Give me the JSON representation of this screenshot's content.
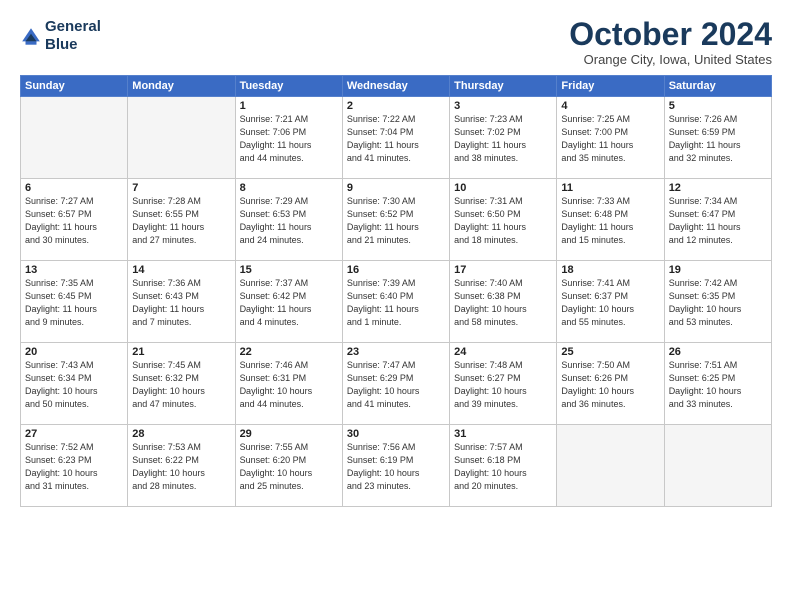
{
  "header": {
    "logo_line1": "General",
    "logo_line2": "Blue",
    "month": "October 2024",
    "location": "Orange City, Iowa, United States"
  },
  "days_of_week": [
    "Sunday",
    "Monday",
    "Tuesday",
    "Wednesday",
    "Thursday",
    "Friday",
    "Saturday"
  ],
  "weeks": [
    [
      {
        "day": "",
        "info": ""
      },
      {
        "day": "",
        "info": ""
      },
      {
        "day": "1",
        "info": "Sunrise: 7:21 AM\nSunset: 7:06 PM\nDaylight: 11 hours\nand 44 minutes."
      },
      {
        "day": "2",
        "info": "Sunrise: 7:22 AM\nSunset: 7:04 PM\nDaylight: 11 hours\nand 41 minutes."
      },
      {
        "day": "3",
        "info": "Sunrise: 7:23 AM\nSunset: 7:02 PM\nDaylight: 11 hours\nand 38 minutes."
      },
      {
        "day": "4",
        "info": "Sunrise: 7:25 AM\nSunset: 7:00 PM\nDaylight: 11 hours\nand 35 minutes."
      },
      {
        "day": "5",
        "info": "Sunrise: 7:26 AM\nSunset: 6:59 PM\nDaylight: 11 hours\nand 32 minutes."
      }
    ],
    [
      {
        "day": "6",
        "info": "Sunrise: 7:27 AM\nSunset: 6:57 PM\nDaylight: 11 hours\nand 30 minutes."
      },
      {
        "day": "7",
        "info": "Sunrise: 7:28 AM\nSunset: 6:55 PM\nDaylight: 11 hours\nand 27 minutes."
      },
      {
        "day": "8",
        "info": "Sunrise: 7:29 AM\nSunset: 6:53 PM\nDaylight: 11 hours\nand 24 minutes."
      },
      {
        "day": "9",
        "info": "Sunrise: 7:30 AM\nSunset: 6:52 PM\nDaylight: 11 hours\nand 21 minutes."
      },
      {
        "day": "10",
        "info": "Sunrise: 7:31 AM\nSunset: 6:50 PM\nDaylight: 11 hours\nand 18 minutes."
      },
      {
        "day": "11",
        "info": "Sunrise: 7:33 AM\nSunset: 6:48 PM\nDaylight: 11 hours\nand 15 minutes."
      },
      {
        "day": "12",
        "info": "Sunrise: 7:34 AM\nSunset: 6:47 PM\nDaylight: 11 hours\nand 12 minutes."
      }
    ],
    [
      {
        "day": "13",
        "info": "Sunrise: 7:35 AM\nSunset: 6:45 PM\nDaylight: 11 hours\nand 9 minutes."
      },
      {
        "day": "14",
        "info": "Sunrise: 7:36 AM\nSunset: 6:43 PM\nDaylight: 11 hours\nand 7 minutes."
      },
      {
        "day": "15",
        "info": "Sunrise: 7:37 AM\nSunset: 6:42 PM\nDaylight: 11 hours\nand 4 minutes."
      },
      {
        "day": "16",
        "info": "Sunrise: 7:39 AM\nSunset: 6:40 PM\nDaylight: 11 hours\nand 1 minute."
      },
      {
        "day": "17",
        "info": "Sunrise: 7:40 AM\nSunset: 6:38 PM\nDaylight: 10 hours\nand 58 minutes."
      },
      {
        "day": "18",
        "info": "Sunrise: 7:41 AM\nSunset: 6:37 PM\nDaylight: 10 hours\nand 55 minutes."
      },
      {
        "day": "19",
        "info": "Sunrise: 7:42 AM\nSunset: 6:35 PM\nDaylight: 10 hours\nand 53 minutes."
      }
    ],
    [
      {
        "day": "20",
        "info": "Sunrise: 7:43 AM\nSunset: 6:34 PM\nDaylight: 10 hours\nand 50 minutes."
      },
      {
        "day": "21",
        "info": "Sunrise: 7:45 AM\nSunset: 6:32 PM\nDaylight: 10 hours\nand 47 minutes."
      },
      {
        "day": "22",
        "info": "Sunrise: 7:46 AM\nSunset: 6:31 PM\nDaylight: 10 hours\nand 44 minutes."
      },
      {
        "day": "23",
        "info": "Sunrise: 7:47 AM\nSunset: 6:29 PM\nDaylight: 10 hours\nand 41 minutes."
      },
      {
        "day": "24",
        "info": "Sunrise: 7:48 AM\nSunset: 6:27 PM\nDaylight: 10 hours\nand 39 minutes."
      },
      {
        "day": "25",
        "info": "Sunrise: 7:50 AM\nSunset: 6:26 PM\nDaylight: 10 hours\nand 36 minutes."
      },
      {
        "day": "26",
        "info": "Sunrise: 7:51 AM\nSunset: 6:25 PM\nDaylight: 10 hours\nand 33 minutes."
      }
    ],
    [
      {
        "day": "27",
        "info": "Sunrise: 7:52 AM\nSunset: 6:23 PM\nDaylight: 10 hours\nand 31 minutes."
      },
      {
        "day": "28",
        "info": "Sunrise: 7:53 AM\nSunset: 6:22 PM\nDaylight: 10 hours\nand 28 minutes."
      },
      {
        "day": "29",
        "info": "Sunrise: 7:55 AM\nSunset: 6:20 PM\nDaylight: 10 hours\nand 25 minutes."
      },
      {
        "day": "30",
        "info": "Sunrise: 7:56 AM\nSunset: 6:19 PM\nDaylight: 10 hours\nand 23 minutes."
      },
      {
        "day": "31",
        "info": "Sunrise: 7:57 AM\nSunset: 6:18 PM\nDaylight: 10 hours\nand 20 minutes."
      },
      {
        "day": "",
        "info": ""
      },
      {
        "day": "",
        "info": ""
      }
    ]
  ]
}
